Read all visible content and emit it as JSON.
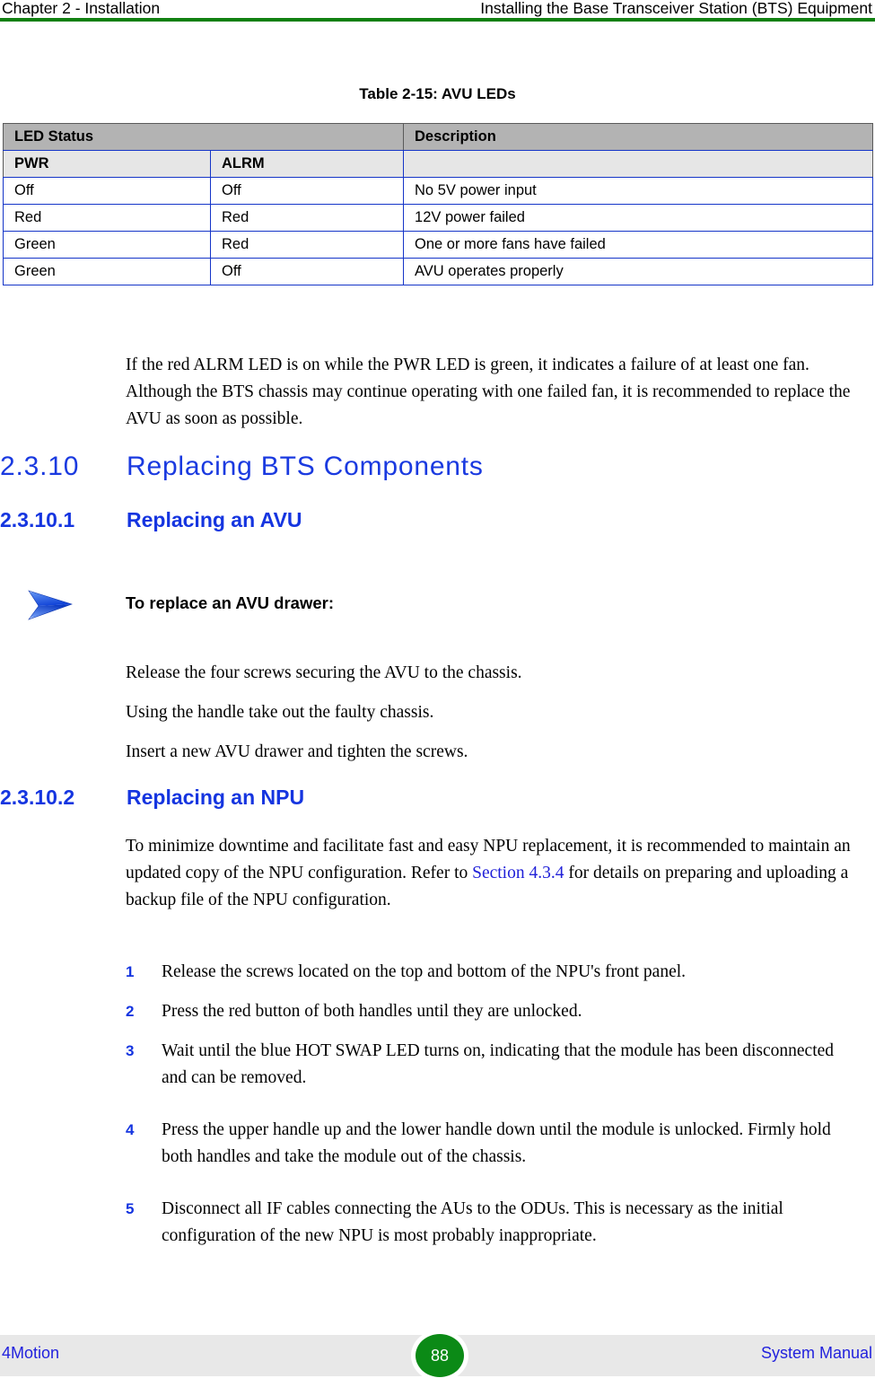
{
  "header": {
    "left": "Chapter 2 - Installation",
    "right": "Installing the Base Transceiver Station (BTS) Equipment",
    "rule_color": "#108010"
  },
  "table": {
    "caption": "Table 2-15: AVU LEDs",
    "header_main": [
      "LED Status",
      "Description"
    ],
    "header_sub": [
      "PWR",
      "ALRM",
      ""
    ],
    "rows": [
      [
        "Off",
        "Off",
        "No 5V power input"
      ],
      [
        "Red",
        "Red",
        "12V power failed"
      ],
      [
        "Green",
        "Red",
        "One or more fans have failed"
      ],
      [
        "Green",
        "Off",
        "AVU operates properly"
      ]
    ],
    "border_color": "#1535c8",
    "header_bg": "#b3b3b3",
    "subheader_bg": "#e6e6e6"
  },
  "intro_paragraph": "If the red ALRM LED is on while the PWR LED is green, it indicates a failure of at least one fan. Although the BTS chassis may continue operating with one failed fan, it is recommended to replace the AVU as soon as possible.",
  "sections": {
    "h2": {
      "number": "2.3.10",
      "title": "Replacing BTS Components",
      "color": "#1a3ae0"
    },
    "h3_avu": {
      "number": "2.3.10.1",
      "title": "Replacing an AVU",
      "color": "#1535e0"
    },
    "h3_npu": {
      "number": "2.3.10.2",
      "title": "Replacing an NPU",
      "color": "#1535e0"
    }
  },
  "procedure_avu": {
    "arrow_icon": "blue-arrow-icon",
    "title": "To replace an AVU drawer:",
    "steps": [
      "Release the four screws securing the AVU to the chassis.",
      "Using the handle take out the faulty chassis.",
      "Insert a new AVU drawer and tighten the screws."
    ]
  },
  "npu_intro": {
    "part1": "To minimize downtime and facilitate fast and easy NPU replacement, it is recommended to maintain an updated copy of the NPU configuration. Refer to ",
    "link": "Section 4.3.4",
    "part2": " for details on preparing and uploading a backup file of the NPU configuration."
  },
  "npu_steps": [
    {
      "num": "1",
      "text": "Release the screws located on the top and bottom of the NPU's front panel."
    },
    {
      "num": "2",
      "text": "Press the red button of both handles until they are unlocked."
    },
    {
      "num": "3",
      "text": "Wait until the blue HOT SWAP LED turns on, indicating that the module has been disconnected and can be removed."
    },
    {
      "num": "4",
      "text": "Press the upper handle up and the lower handle down until the module is unlocked. Firmly hold both handles and take the module out of the chassis."
    },
    {
      "num": "5",
      "text": "Disconnect all IF cables connecting the AUs to the ODUs. This is necessary as the initial configuration of the new NPU is most probably inappropriate."
    }
  ],
  "footer": {
    "left": "4Motion",
    "page_number": "88",
    "right": "System Manual",
    "badge_color": "#0b8a16",
    "band_color": "#e8e8e8"
  }
}
